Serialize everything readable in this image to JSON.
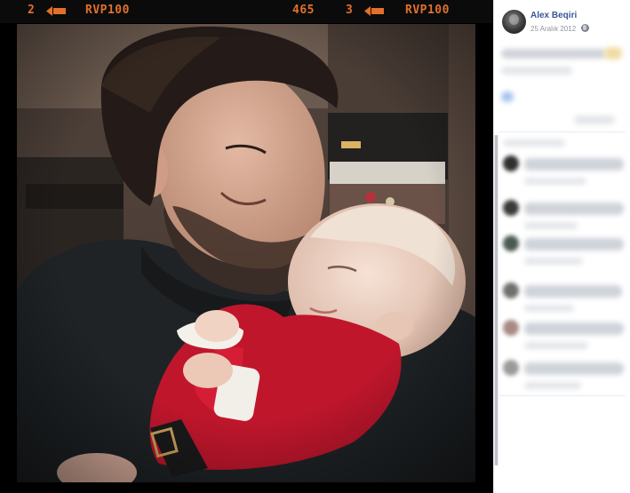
{
  "film_strip": {
    "frame_left": "2",
    "film_left": "RVP100",
    "counter": "465",
    "frame_right": "3",
    "film_right": "RVP100",
    "accent_color": "#e1702c"
  },
  "photo": {
    "description_icon": "photo-content"
  },
  "post": {
    "author": "Alex Beqiri",
    "date": "25 Aralık 2012",
    "privacy_icon": "globe-icon"
  },
  "colors": {
    "viewer_background": "#000000",
    "link_blue": "#385898",
    "meta_gray": "#90949c"
  }
}
